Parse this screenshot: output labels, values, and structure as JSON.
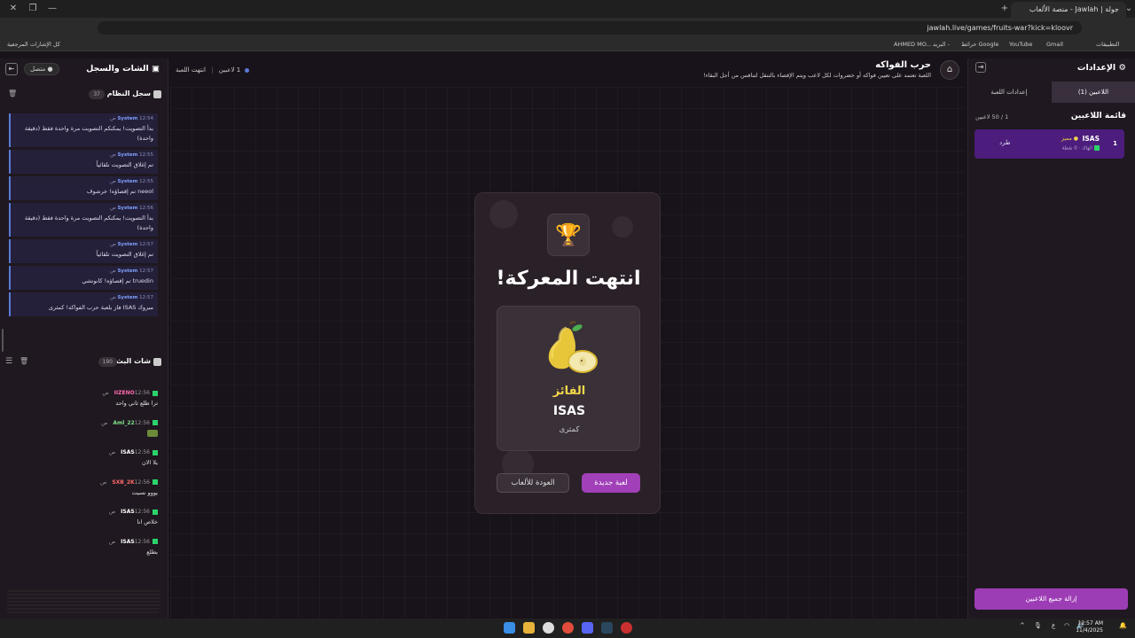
{
  "browser": {
    "tab_title": "جولة | Jawlah - منصة الألعاب",
    "url": "jawlah.live/games/fruits-war?kick=kloovr",
    "bookmarks": [
      "التطبيقات",
      "Gmail",
      "YouTube",
      "خرائط Google",
      "البريد -",
      "AHMED MO..."
    ],
    "all_bookmarks": "كل الإشارات المرجعية"
  },
  "header": {
    "game_title": "حرب الفواكه",
    "game_subtitle": "اللعبة تعتمد على تعيين فواكه أو خضروات لكل لاعب ويتم الإقصاء بالتنقل لتنافس من أجل البقاء!",
    "players_status": "1 لاعبين",
    "game_status": "انتهت اللعبة"
  },
  "left": {
    "title": "الشات والسجل",
    "status": "متصل",
    "syslog_title": "سجل النظام",
    "syslog_count": "37",
    "syslog": [
      {
        "who": "System",
        "time": "12:54 ص",
        "text": "بدأ التصويت! يمكنكم التصويت مرة واحدة فقط (دقيقة واحدة)"
      },
      {
        "who": "System",
        "time": "12:55 ص",
        "text": "تم إغلاق التصويت تلقائياً"
      },
      {
        "who": "System",
        "time": "12:55 ص",
        "text": "neeol تم إقصاؤه! خرشوف"
      },
      {
        "who": "System",
        "time": "12:56 ص",
        "text": "بدأ التصويت! يمكنكم التصويت مرة واحدة فقط (دقيقة واحدة)"
      },
      {
        "who": "System",
        "time": "12:57 ص",
        "text": "تم إغلاق التصويت تلقائياً"
      },
      {
        "who": "System",
        "time": "12:57 ص",
        "text": "truedin تم إقصاؤه! كانوتشي"
      },
      {
        "who": "System",
        "time": "12:57 ص",
        "text": "مبروك ISAS فاز بلعبة حرب الفواكه! كمثرى"
      }
    ],
    "chat_title": "شات البث",
    "chat_count": "190",
    "chat": [
      {
        "user": "IIZENO",
        "color": "#ff6ab0",
        "time": "12:56 ص",
        "text": "ترا طلع ثاني واحد"
      },
      {
        "user": "Aml_22",
        "color": "#7fe08a",
        "time": "12:56 ص",
        "text": ""
      },
      {
        "user": "ISAS",
        "color": "#ffffff",
        "time": "12:56 ص",
        "text": "يلا الان"
      },
      {
        "user": "SXB_2K",
        "color": "#ff6a6a",
        "time": "12:56 ص",
        "text": "يووو نسيت"
      },
      {
        "user": "ISAS",
        "color": "#ffffff",
        "time": "12:56 ص",
        "text": "خلاص انا"
      },
      {
        "user": "ISAS",
        "color": "#ffffff",
        "time": "12:56 ص",
        "text": "بطلع"
      }
    ]
  },
  "right": {
    "title": "الإعدادات",
    "tab_players": "اللاعبين (1)",
    "tab_settings": "إعدادات اللعبة",
    "list_title": "قائمة اللاعبين",
    "list_count": "1 / 50 لاعبين",
    "player": {
      "num": "1",
      "name": "ISAS",
      "badge": "مميز",
      "sub": "الهاك · 0 نقطة",
      "kick": "طرد"
    },
    "remove_all": "إزالة جميع اللاعبين"
  },
  "result": {
    "title": "انتهت المعركة!",
    "winner_label": "الفائز",
    "winner_name": "ISAS",
    "winner_fruit": "كمثرى",
    "new_game": "لعبة جديدة",
    "back": "العودة للألعاب"
  },
  "taskbar": {
    "time": "12:57 AM",
    "date": "11/4/2025",
    "lang": "ع"
  },
  "colors": {
    "accent": "#a140b8",
    "player_card": "#4c1d7c",
    "gold": "#f4d84a"
  }
}
